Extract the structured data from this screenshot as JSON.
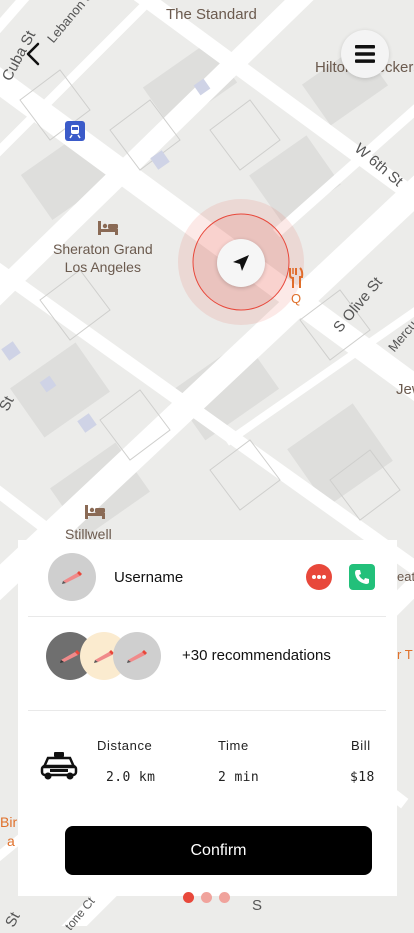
{
  "map": {
    "labels": {
      "the_standard": "The Standard",
      "hilton_checkers": "Hilton Checkers",
      "lebanon_st": "Lebanon St",
      "cuba_st": "Cuba St",
      "w_6th_st": "W 6th St",
      "sheraton_line1": "Sheraton Grand",
      "sheraton_line2": "Los Angeles",
      "s_olive_st": "S Olive St",
      "mercury": "Mercu",
      "jew": "Jew",
      "stillwell": "Stillwell",
      "st_left": "St",
      "q": "Q",
      "bir": "Bir",
      "a": "a",
      "eatr": "eatr",
      "rt": "r T",
      "st_bottom": "St",
      "stone_ct": "tone Ct",
      "s_bottom": "S"
    },
    "colors": {
      "land": "#ececea",
      "block": "#dededc",
      "road": "#ffffff",
      "pulse": "#e8483b"
    }
  },
  "header": {
    "back_icon": "chevron-left-icon",
    "menu_icon": "hamburger-menu-icon"
  },
  "driver": {
    "username": "Username",
    "chat_icon": "chat-bubble-icon",
    "call_icon": "phone-icon",
    "colors": {
      "chat": "#e8483b",
      "call": "#22c07a"
    }
  },
  "recommendations": {
    "label": "+30 recommendations"
  },
  "trip": {
    "headers": {
      "distance": "Distance",
      "time": "Time",
      "bill": "Bill"
    },
    "values": {
      "distance": "2.0 km",
      "time": "2 min",
      "bill": "$18"
    },
    "icon": "taxi-icon"
  },
  "confirm": {
    "label": "Confirm"
  },
  "pager": {
    "count": 3,
    "active": 1,
    "colors": {
      "active": "#e8483b",
      "inactive": "#f0a39c"
    }
  }
}
